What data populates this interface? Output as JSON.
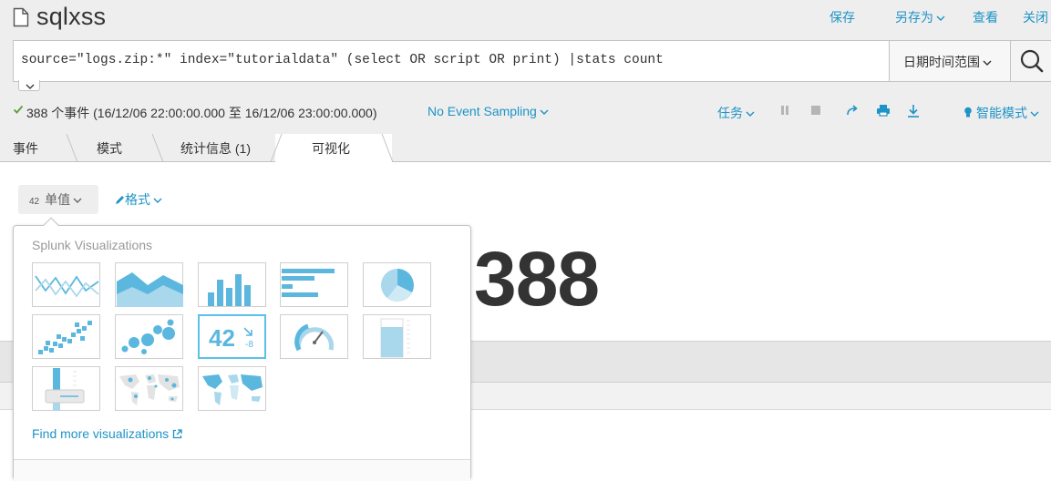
{
  "app": {
    "title": "sqlxss",
    "actions": {
      "save": "保存",
      "save_as": "另存为",
      "view": "查看",
      "close": "关闭"
    }
  },
  "search": {
    "query": "source=\"logs.zip:*\" index=\"tutorialdata\" (select OR script OR print) |stats count",
    "time_range": "日期时间范围"
  },
  "status": {
    "event_summary": "388 个事件 (16/12/06 22:00:00.000 至 16/12/06 23:00:00.000)",
    "sampling": "No Event Sampling",
    "job": "任务",
    "mode": "智能模式"
  },
  "tabs": [
    {
      "label": "事件"
    },
    {
      "label": "模式"
    },
    {
      "label": "统计信息 (1)"
    },
    {
      "label": "可视化"
    }
  ],
  "viz_toolbar": {
    "type_icon_text": "42",
    "type_label": "单值",
    "format_label": "格式"
  },
  "result": {
    "value": "388"
  },
  "picker": {
    "heading": "Splunk Visualizations",
    "tiles": [
      {
        "icon": "line-chart-icon"
      },
      {
        "icon": "area-chart-icon"
      },
      {
        "icon": "column-chart-icon"
      },
      {
        "icon": "bar-chart-icon"
      },
      {
        "icon": "pie-chart-icon"
      },
      {
        "icon": "scatter-chart-icon"
      },
      {
        "icon": "bubble-chart-icon"
      },
      {
        "icon": "single-value-icon",
        "big": "42",
        "small": "-8",
        "selected": true
      },
      {
        "icon": "radial-gauge-icon"
      },
      {
        "icon": "filler-gauge-icon"
      },
      {
        "icon": "marker-gauge-icon"
      },
      {
        "icon": "cluster-map-icon"
      },
      {
        "icon": "choropleth-map-icon"
      }
    ],
    "find_more": "Find more visualizations"
  },
  "colors": {
    "accent": "#1e93c6",
    "viz_blue": "#5bb7de",
    "viz_light": "#a9d7ec",
    "selected_border": "#5cc0e8"
  }
}
